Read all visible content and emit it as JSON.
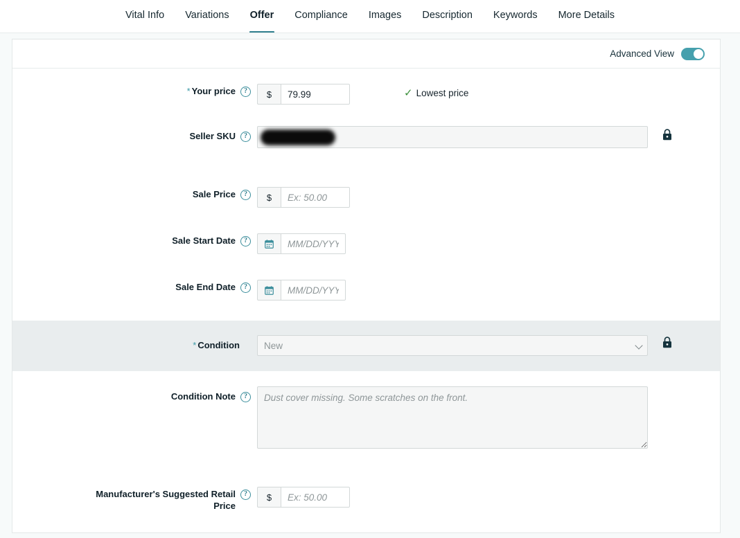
{
  "tabs": [
    {
      "label": "Vital Info",
      "active": false
    },
    {
      "label": "Variations",
      "active": false
    },
    {
      "label": "Offer",
      "active": true
    },
    {
      "label": "Compliance",
      "active": false
    },
    {
      "label": "Images",
      "active": false
    },
    {
      "label": "Description",
      "active": false
    },
    {
      "label": "Keywords",
      "active": false
    },
    {
      "label": "More Details",
      "active": false
    }
  ],
  "header": {
    "advanced_view_label": "Advanced View",
    "advanced_view_on": true,
    "accent_color": "#46a0ad"
  },
  "icons": {
    "help": "?",
    "dollar": "$",
    "check": "✓"
  },
  "fields": {
    "your_price": {
      "label": "Your price",
      "required": true,
      "required_marker": "*",
      "currency_prefix": "$",
      "value": "79.99",
      "status_text": "Lowest price",
      "status_color": "#3a8f3a"
    },
    "seller_sku": {
      "label": "Seller SKU",
      "required": false,
      "value": "",
      "redacted": true,
      "locked": true
    },
    "sale_price": {
      "label": "Sale Price",
      "required": false,
      "currency_prefix": "$",
      "value": "",
      "placeholder": "Ex: 50.00"
    },
    "sale_start_date": {
      "label": "Sale Start Date",
      "required": false,
      "value": "",
      "placeholder": "MM/DD/YYYY"
    },
    "sale_end_date": {
      "label": "Sale End Date",
      "required": false,
      "value": "",
      "placeholder": "MM/DD/YYYY"
    },
    "condition": {
      "label": "Condition",
      "required": true,
      "required_marker": "*",
      "selected": "New",
      "options": [
        "New"
      ],
      "locked": true,
      "highlighted": true
    },
    "condition_note": {
      "label": "Condition Note",
      "required": false,
      "value": "",
      "placeholder": "Dust cover missing. Some scratches on the front."
    },
    "msrp": {
      "label": "Manufacturer's Suggested Retail Price",
      "label_line1": "Manufacturer's Suggested Retail",
      "label_line2": "Price",
      "required": false,
      "currency_prefix": "$",
      "value": "",
      "placeholder": "Ex: 50.00"
    }
  }
}
